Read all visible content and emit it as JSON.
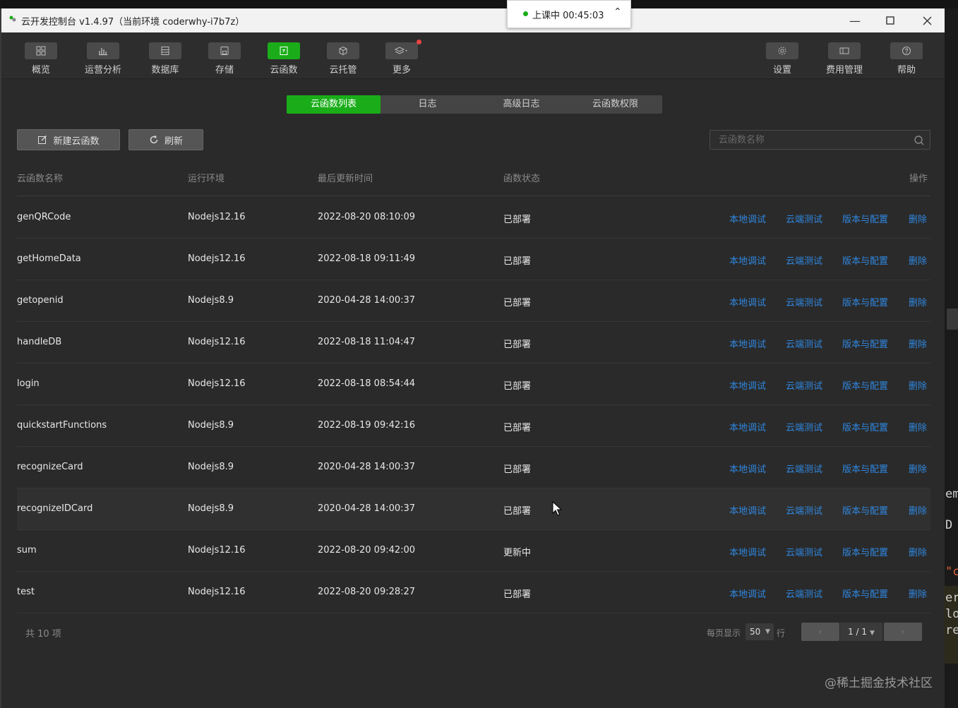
{
  "window": {
    "title": "云开发控制台 v1.4.97（当前环境 coderwhy-i7b7z）",
    "timer_text": "上课中 00:45:03"
  },
  "toolbar": {
    "left": [
      {
        "label": "概览",
        "icon": "grid-icon"
      },
      {
        "label": "运营分析",
        "icon": "bar-chart-icon"
      },
      {
        "label": "数据库",
        "icon": "database-icon"
      },
      {
        "label": "存储",
        "icon": "storage-icon"
      },
      {
        "label": "云函数",
        "icon": "function-icon",
        "active": true
      },
      {
        "label": "云托管",
        "icon": "cube-icon"
      },
      {
        "label": "更多",
        "icon": "layers-icon"
      }
    ],
    "right": [
      {
        "label": "设置",
        "icon": "gear-icon"
      },
      {
        "label": "费用管理",
        "icon": "billing-icon"
      },
      {
        "label": "帮助",
        "icon": "help-icon"
      }
    ]
  },
  "tabs": [
    "云函数列表",
    "日志",
    "高级日志",
    "云函数权限"
  ],
  "actions": {
    "new_label": "新建云函数",
    "refresh_label": "刷新"
  },
  "search": {
    "placeholder": "云函数名称"
  },
  "table": {
    "headers": {
      "name": "云函数名称",
      "runtime": "运行环境",
      "updated": "最后更新时间",
      "status": "函数状态",
      "ops": "操作"
    },
    "op_labels": {
      "local": "本地调试",
      "cloud": "云端测试",
      "version": "版本与配置",
      "delete": "删除"
    },
    "rows": [
      {
        "name": "genQRCode",
        "runtime": "Nodejs12.16",
        "updated": "2022-08-20 08:10:09",
        "status": "已部署"
      },
      {
        "name": "getHomeData",
        "runtime": "Nodejs12.16",
        "updated": "2022-08-18 09:11:49",
        "status": "已部署"
      },
      {
        "name": "getopenid",
        "runtime": "Nodejs8.9",
        "updated": "2020-04-28 14:00:37",
        "status": "已部署"
      },
      {
        "name": "handleDB",
        "runtime": "Nodejs12.16",
        "updated": "2022-08-18 11:04:47",
        "status": "已部署"
      },
      {
        "name": "login",
        "runtime": "Nodejs12.16",
        "updated": "2022-08-18 08:54:44",
        "status": "已部署"
      },
      {
        "name": "quickstartFunctions",
        "runtime": "Nodejs8.9",
        "updated": "2022-08-19 09:42:16",
        "status": "已部署"
      },
      {
        "name": "recognizeCard",
        "runtime": "Nodejs8.9",
        "updated": "2020-04-28 14:00:37",
        "status": "已部署"
      },
      {
        "name": "recognizeIDCard",
        "runtime": "Nodejs8.9",
        "updated": "2020-04-28 14:00:37",
        "status": "已部署"
      },
      {
        "name": "sum",
        "runtime": "Nodejs12.16",
        "updated": "2022-08-20 09:42:00",
        "status": "更新中"
      },
      {
        "name": "test",
        "runtime": "Nodejs12.16",
        "updated": "2022-08-20 09:28:27",
        "status": "已部署"
      }
    ]
  },
  "footer": {
    "count": "共 10 项",
    "per_page_label": "每页显示",
    "per_page": "50",
    "row_unit": "行",
    "page": "1 / 1"
  },
  "side_fragments": [
    "em",
    "D",
    "\"c",
    "er",
    "lo",
    "re"
  ],
  "watermark": "@稀土掘金技术社区",
  "colors": {
    "accent": "#1aad19",
    "link": "#2f87e0",
    "badge": "#e64340"
  }
}
